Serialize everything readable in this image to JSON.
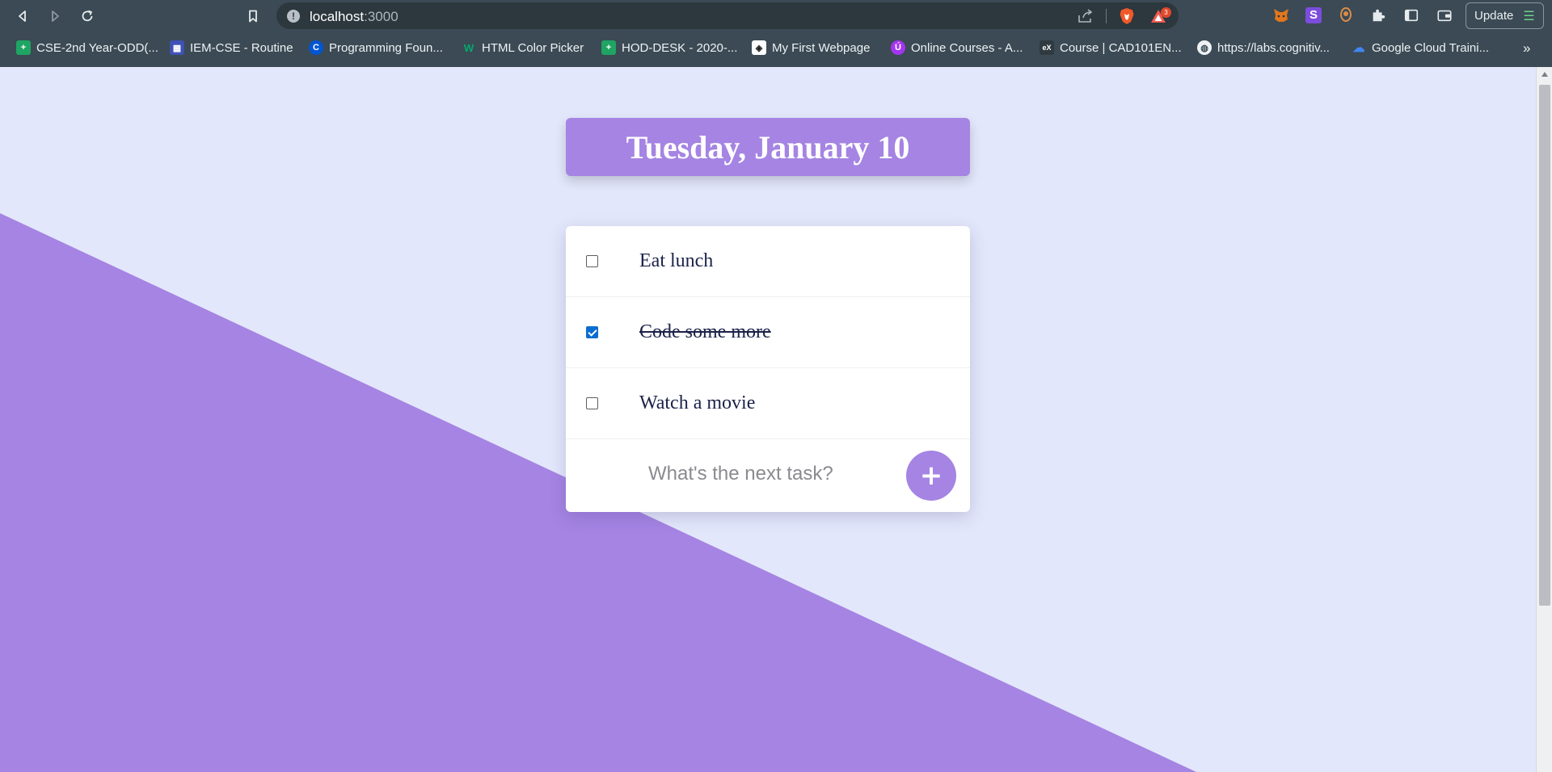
{
  "browser": {
    "url_host": "localhost",
    "url_port": ":3000",
    "rewards_badge": "3",
    "update_label": "Update",
    "update_menu_glyph": "☰",
    "bookmarks_more": "»",
    "extension_s_label": "S",
    "bookmarks": [
      {
        "label": "CSE-2nd Year-ODD(...",
        "icon": "google-sheets-icon",
        "icon_text": "+",
        "color": "#1fa463"
      },
      {
        "label": "IEM-CSE - Routine",
        "icon": "calendar-icon",
        "icon_text": "▦",
        "color": "#3f51b5"
      },
      {
        "label": "Programming Foun...",
        "icon": "coursera-icon",
        "icon_text": "C",
        "color": "#0056d2"
      },
      {
        "label": "HTML Color Picker",
        "icon": "w3schools-icon",
        "icon_text": "W",
        "color": "#04aa6d"
      },
      {
        "label": "HOD-DESK - 2020-...",
        "icon": "google-sheets-icon",
        "icon_text": "+",
        "color": "#1fa463"
      },
      {
        "label": "My First Webpage",
        "icon": "codepen-icon",
        "icon_text": "◈",
        "color": "#ffffff"
      },
      {
        "label": "Online Courses - A...",
        "icon": "udemy-icon",
        "icon_text": "Ú",
        "color": "#a435f0"
      },
      {
        "label": "Course | CAD101EN...",
        "icon": "edx-icon",
        "icon_text": "eX",
        "color": "#2f3a40"
      },
      {
        "label": "https://labs.cognitiv...",
        "icon": "globe-icon",
        "icon_text": "◍",
        "color": "#eef2f4"
      },
      {
        "label": "Google Cloud Traini...",
        "icon": "google-cloud-icon",
        "icon_text": "☁",
        "color": "#4285f4"
      }
    ]
  },
  "app": {
    "date_heading": "Tuesday, January 10",
    "items": [
      {
        "text": "Eat lunch",
        "checked": false
      },
      {
        "text": "Code some more",
        "checked": true
      },
      {
        "text": "Watch a movie",
        "checked": false
      }
    ],
    "input_placeholder": "What's the next task?",
    "add_label": "+"
  },
  "colors": {
    "accent": "#a584e3",
    "page_background": "#e3e7fb",
    "chrome": "#3b4a54"
  }
}
